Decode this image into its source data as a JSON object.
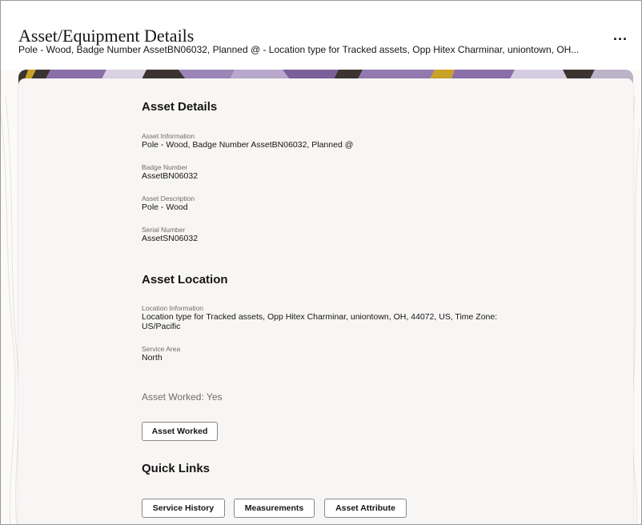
{
  "header": {
    "title": "Asset/Equipment Details",
    "subtitle": "Pole - Wood, Badge Number AssetBN06032, Planned @ - Location type for Tracked assets, Opp Hitex Charminar, uniontown, OH...",
    "more_label": "..."
  },
  "asset_details": {
    "heading": "Asset Details",
    "fields": [
      {
        "label": "Asset Information",
        "value": "Pole - Wood, Badge Number AssetBN06032, Planned @"
      },
      {
        "label": "Badge Number",
        "value": "AssetBN06032"
      },
      {
        "label": "Asset Description",
        "value": "Pole - Wood"
      },
      {
        "label": "Serial Number",
        "value": "AssetSN06032"
      }
    ]
  },
  "asset_location": {
    "heading": "Asset Location",
    "fields": [
      {
        "label": "Location Information",
        "value_line1": "Location type for Tracked assets, Opp Hitex Charminar, uniontown, OH, 44072, US, Time Zone:",
        "value_line2": "US/Pacific"
      },
      {
        "label": "Service Area",
        "value": "North"
      }
    ]
  },
  "asset_worked": {
    "status": "Asset Worked: Yes",
    "button_label": "Asset Worked"
  },
  "quick_links": {
    "heading": "Quick Links",
    "buttons": [
      "Service History",
      "Measurements",
      "Asset Attribute"
    ]
  },
  "colors": {
    "banner_purple": "#8a6fa8",
    "banner_dark": "#3b3431",
    "banner_gold": "#c9a227",
    "text": "#161513",
    "muted": "#6f6c69"
  }
}
